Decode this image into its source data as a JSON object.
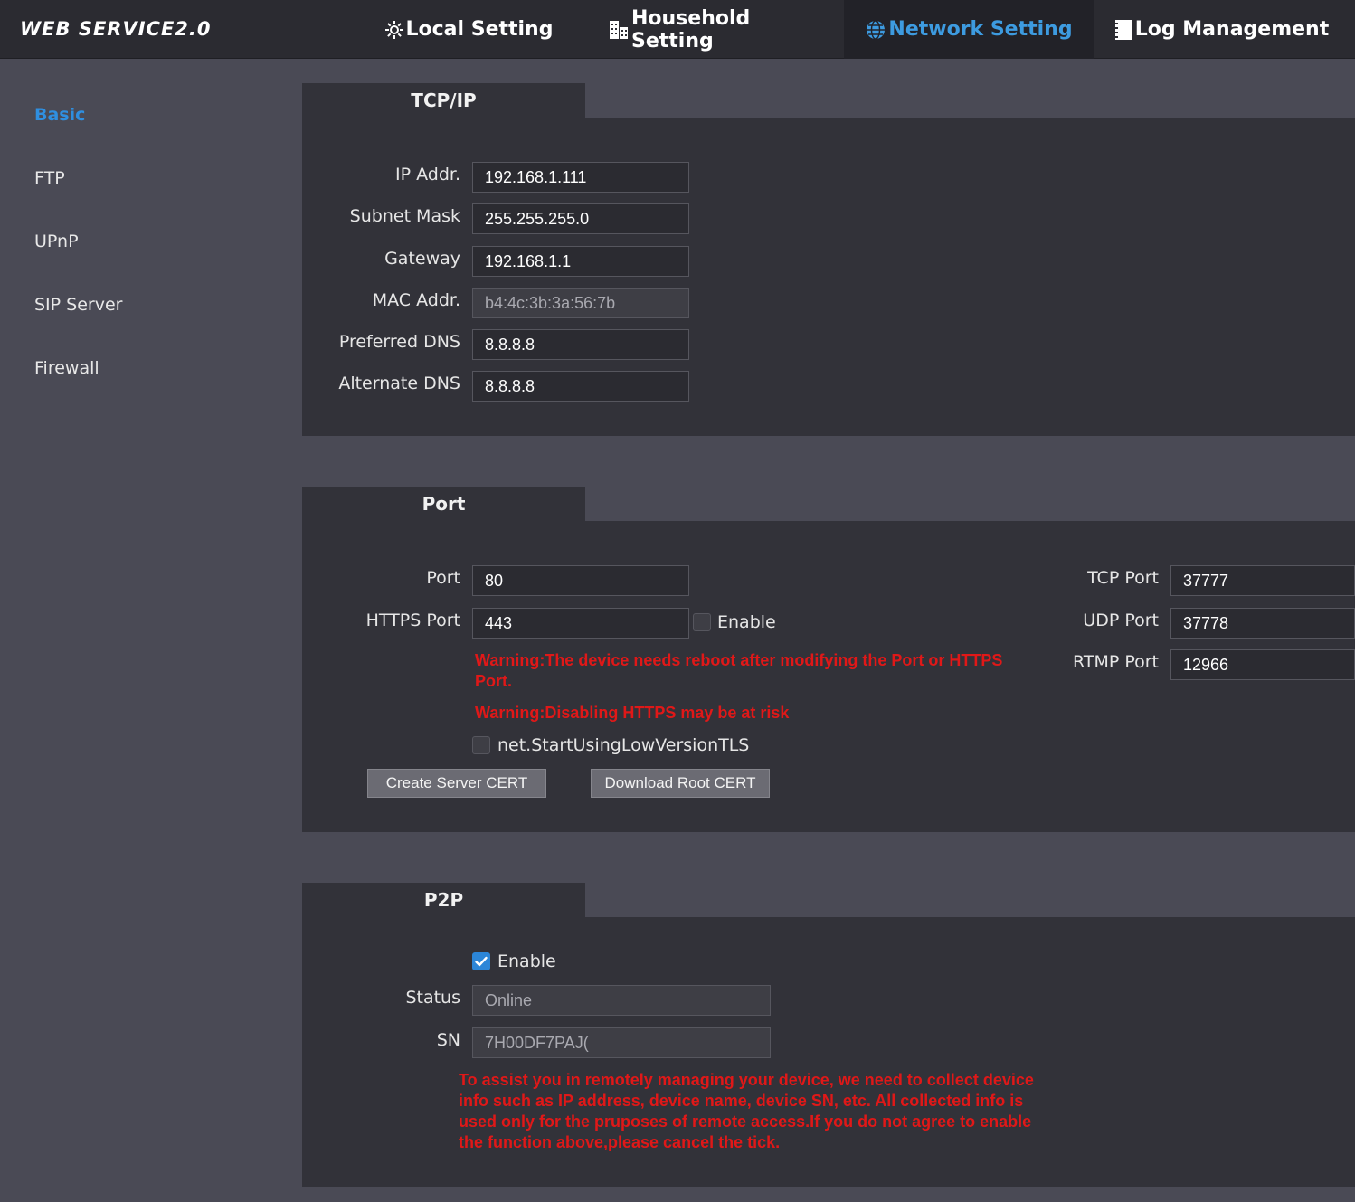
{
  "app": {
    "logo": "WEB SERVICE2.0"
  },
  "nav": {
    "tabs": [
      {
        "label": "Local Setting",
        "icon": "gear-icon"
      },
      {
        "label": "Household Setting",
        "icon": "building-icon"
      },
      {
        "label": "Network Setting",
        "icon": "globe-icon",
        "active": true
      },
      {
        "label": "Log Management",
        "icon": "document-icon"
      }
    ]
  },
  "sidebar": {
    "items": [
      {
        "label": "Basic",
        "active": true
      },
      {
        "label": "FTP"
      },
      {
        "label": "UPnP"
      },
      {
        "label": "SIP Server"
      },
      {
        "label": "Firewall"
      }
    ]
  },
  "tcpip": {
    "title": "TCP/IP",
    "ip_label": "IP Addr.",
    "ip_value": "192.168.1.111",
    "mask_label": "Subnet Mask",
    "mask_value": "255.255.255.0",
    "gateway_label": "Gateway",
    "gateway_value": "192.168.1.1",
    "mac_label": "MAC Addr.",
    "mac_value": "b4:4c:3b:3a:56:7b",
    "dns1_label": "Preferred DNS",
    "dns1_value": "8.8.8.8",
    "dns2_label": "Alternate DNS",
    "dns2_value": "8.8.8.8"
  },
  "port": {
    "title": "Port",
    "port_label": "Port",
    "port_value": "80",
    "https_label": "HTTPS Port",
    "https_value": "443",
    "https_enable_label": "Enable",
    "https_enabled": false,
    "warning1": "Warning:The device needs reboot after modifying the Port or HTTPS Port.",
    "warning2": "Warning:Disabling HTTPS may be at risk",
    "tls_label": "net.StartUsingLowVersionTLS",
    "tls_checked": false,
    "create_cert_button": "Create Server CERT",
    "download_cert_button": "Download Root CERT",
    "tcp_label": "TCP Port",
    "tcp_value": "37777",
    "udp_label": "UDP Port",
    "udp_value": "37778",
    "rtmp_label": "RTMP Port",
    "rtmp_value": "12966"
  },
  "p2p": {
    "title": "P2P",
    "enable_label": "Enable",
    "enabled": true,
    "status_label": "Status",
    "status_value": "Online",
    "sn_label": "SN",
    "sn_value": "7H00DF7PAJ(",
    "notice": "To assist you in remotely managing your device, we need to collect device info such as IP address, device name, device SN, etc. All collected info is used only for the pruposes of remote access.If you do not agree to enable the function above,please cancel the tick."
  },
  "colors": {
    "accent": "#2f8fe0",
    "warning": "#e01818",
    "panel_bg": "#323239",
    "page_bg": "#4a4a55"
  }
}
